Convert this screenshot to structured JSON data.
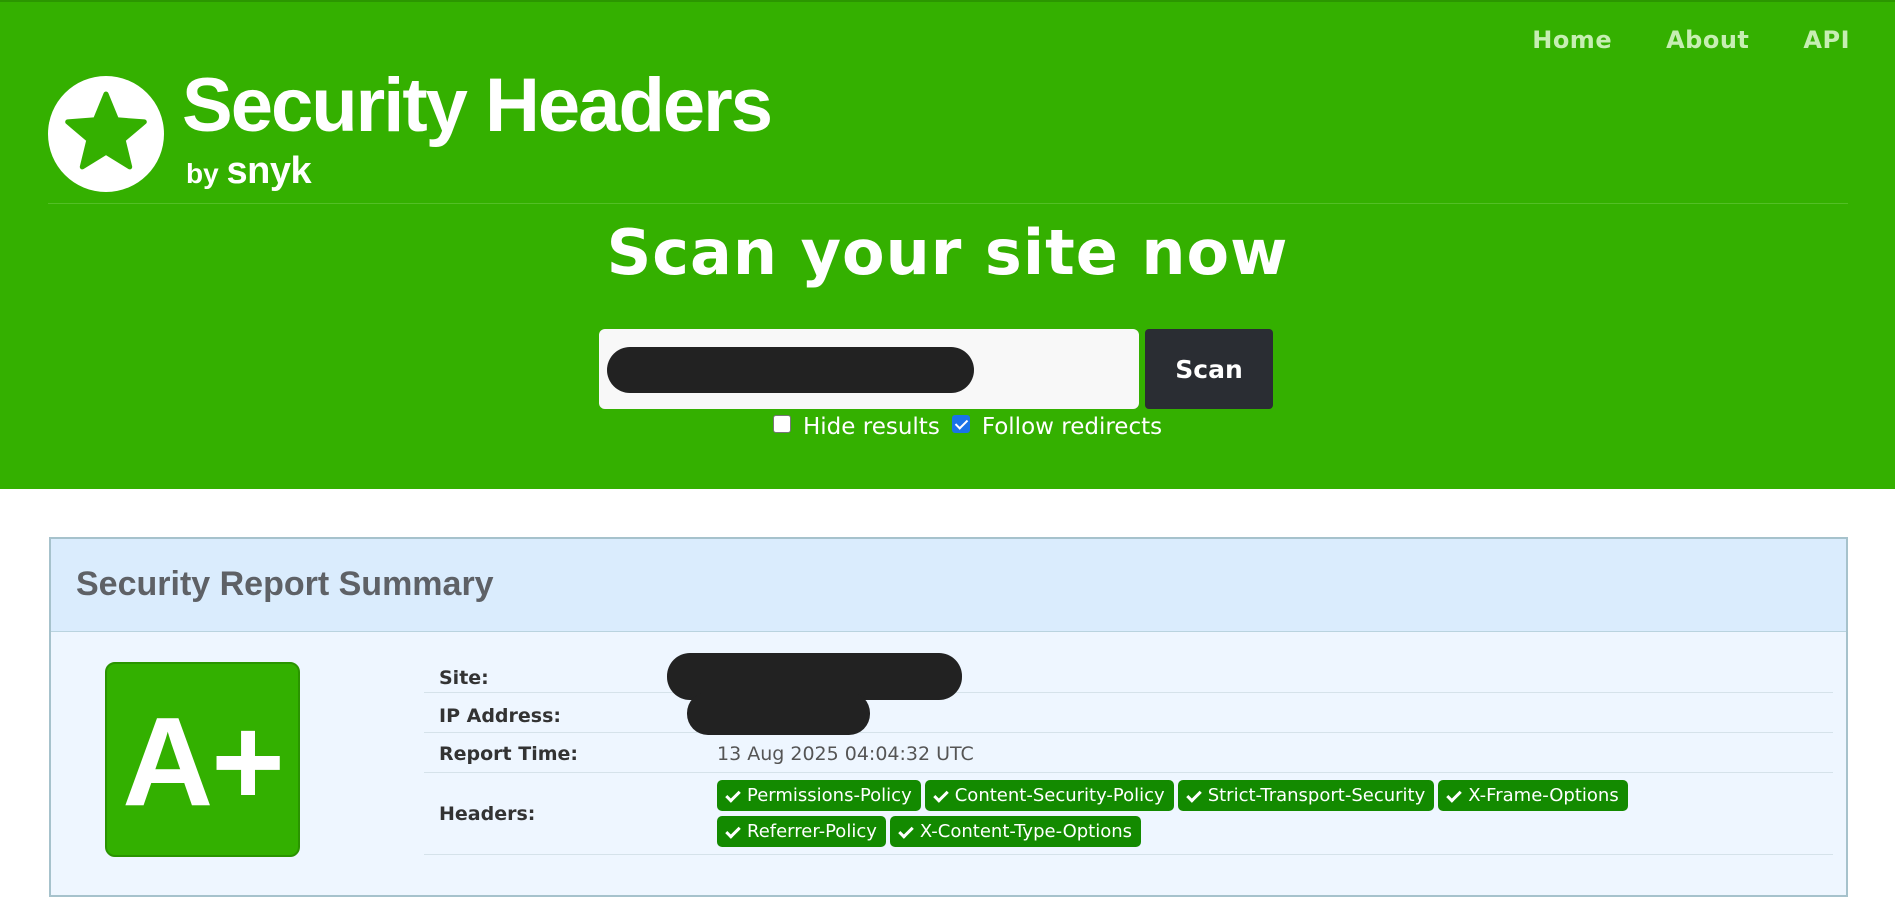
{
  "nav": {
    "items": [
      "Home",
      "About",
      "API"
    ]
  },
  "brand": {
    "title": "Security Headers",
    "by": "by",
    "company": "snyk",
    "logo_icon": "star-icon"
  },
  "scan": {
    "heading": "Scan your site now",
    "input_value": "[redacted]",
    "button_label": "Scan",
    "hide_results": {
      "label": "Hide results",
      "checked": false
    },
    "follow_redirects": {
      "label": "Follow redirects",
      "checked": true
    }
  },
  "report": {
    "title": "Security Report Summary",
    "grade": "A+",
    "rows": {
      "site_label": "Site:",
      "ip_label": "IP Address:",
      "time_label": "Report Time:",
      "time_value": "13 Aug 2025 04:04:32 UTC",
      "headers_label": "Headers:"
    },
    "headers": [
      "Permissions-Policy",
      "Content-Security-Policy",
      "Strict-Transport-Security",
      "X-Frame-Options",
      "Referrer-Policy",
      "X-Content-Type-Options"
    ]
  },
  "colors": {
    "brand_green": "#34b000",
    "badge_green": "#138a00",
    "report_bg": "#eef6ff"
  }
}
